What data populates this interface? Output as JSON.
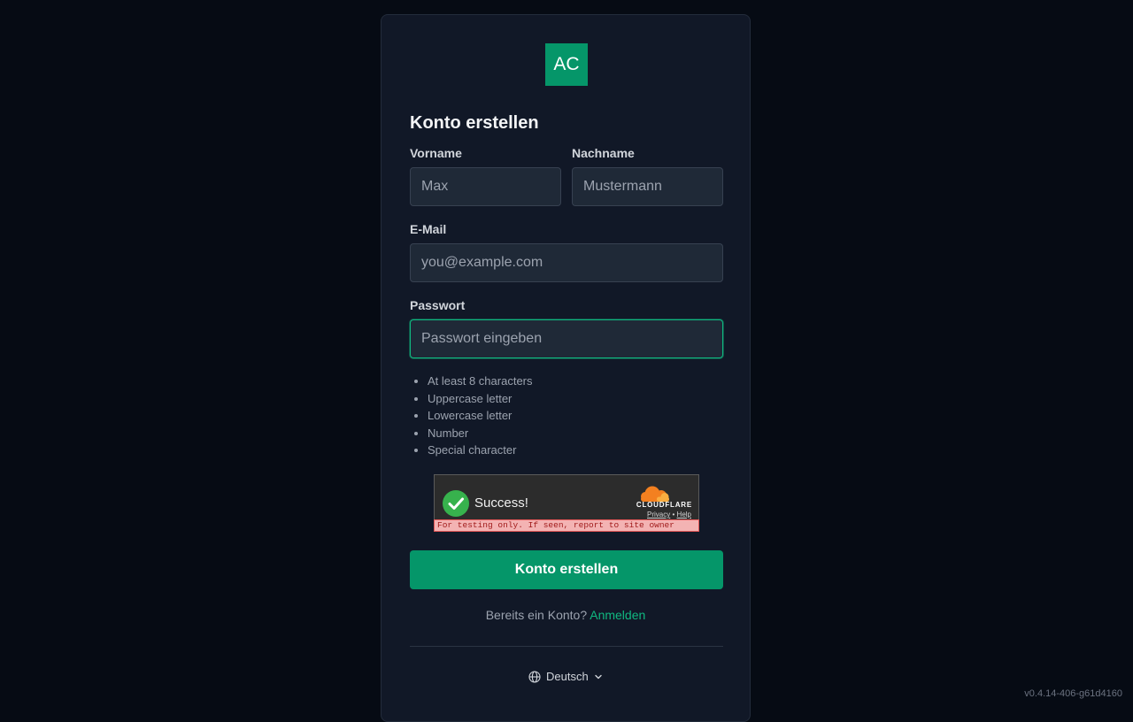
{
  "brand": {
    "logo_text": "AC"
  },
  "form": {
    "title": "Konto erstellen",
    "first_name": {
      "label": "Vorname",
      "placeholder": "Max",
      "value": ""
    },
    "last_name": {
      "label": "Nachname",
      "placeholder": "Mustermann",
      "value": ""
    },
    "email": {
      "label": "E-Mail",
      "placeholder": "you@example.com",
      "value": ""
    },
    "password": {
      "label": "Passwort",
      "placeholder": "Passwort eingeben",
      "value": ""
    },
    "password_requirements": [
      "At least 8 characters",
      "Uppercase letter",
      "Lowercase letter",
      "Number",
      "Special character"
    ],
    "submit_label": "Konto erstellen"
  },
  "captcha": {
    "status": "Success!",
    "brand": "CLOUDFLARE",
    "privacy_label": "Privacy",
    "separator": "•",
    "help_label": "Help",
    "warning": "For testing only. If seen, report to site owner"
  },
  "signin": {
    "prompt": "Bereits ein Konto?",
    "link_label": "Anmelden"
  },
  "language": {
    "selected": "Deutsch"
  },
  "footer": {
    "version": "v0.4.14-406-g61d4160"
  },
  "colors": {
    "accent": "#059669",
    "background": "#060b14",
    "card": "#111827"
  }
}
